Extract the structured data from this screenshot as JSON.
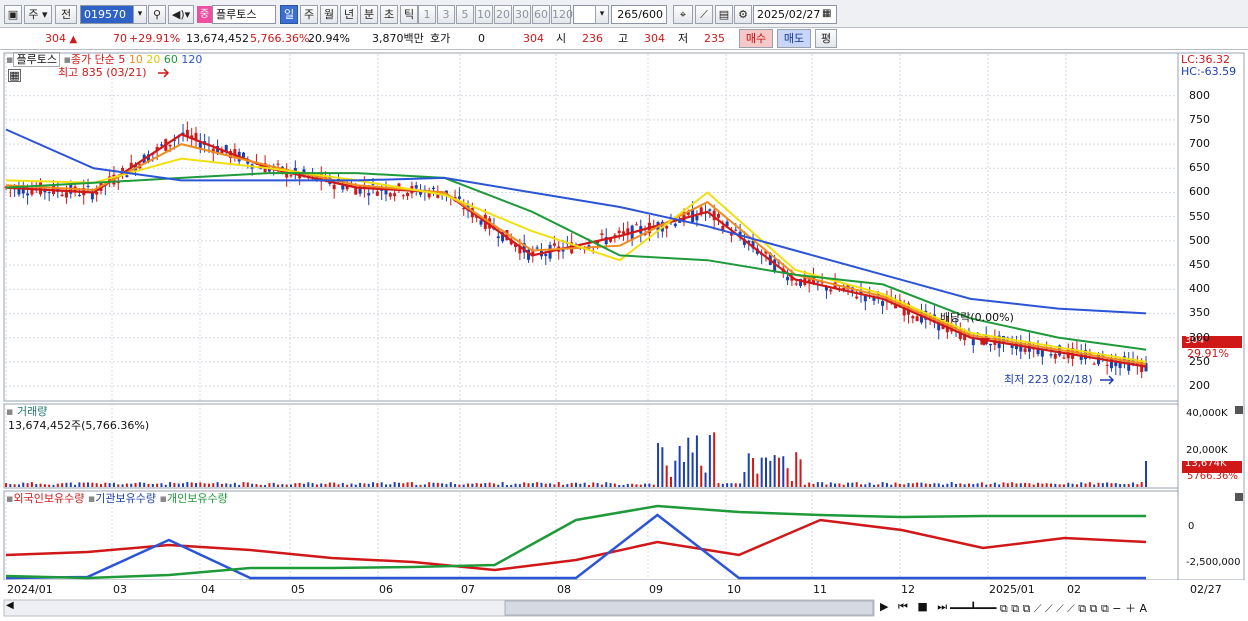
{
  "toolbar": {
    "period_type": "주",
    "prev_label": "전",
    "code": "019570",
    "stock_badge": "중",
    "stock_name": "플루토스",
    "periods": [
      "일",
      "주",
      "월",
      "년",
      "분",
      "초",
      "틱"
    ],
    "minutes": [
      "1",
      "3",
      "5",
      "10",
      "20",
      "30",
      "60",
      "120"
    ],
    "count": "265",
    "count_total": "/600",
    "date": "2025/02/27"
  },
  "quote": {
    "price": "304",
    "change": "70",
    "change_pct": "+29.91%",
    "volume": "13,674,452",
    "volume_ratio": "5,766.36%",
    "turnover": "20.94%",
    "amount": "3,870백만",
    "hoga_label": "호가",
    "hoga_value": "0",
    "hoga_price": "304",
    "open_label": "시",
    "open": "236",
    "high_label": "고",
    "high": "304",
    "low_label": "저",
    "low": "235",
    "buy_label": "매수",
    "sell_label": "매도",
    "eval_label": "평"
  },
  "price_panel": {
    "legend_name": "플루토스",
    "legend_ma": "종가 단순",
    "ma_periods": [
      "5",
      "10",
      "20",
      "60",
      "120"
    ],
    "ma_colors": [
      "#d01818",
      "#f08c1c",
      "#f0e010",
      "#1f9a3a",
      "#2b55d6"
    ],
    "high_note": "최고 835 (03/21)",
    "low_note": "최저 223 (02/18)",
    "dividend_note": "배당락(0.00%)",
    "lc": "LC:36.32",
    "hc": "HC:-63.59",
    "axis_ticks": [
      "800",
      "750",
      "700",
      "650",
      "600",
      "550",
      "500",
      "450",
      "400",
      "350",
      "300",
      "250",
      "200"
    ],
    "current_label": "304",
    "current_pct": "29.91%"
  },
  "volume_panel": {
    "title": "거래량",
    "value": "13,674,452주(5,766.36%)",
    "axis_ticks": [
      "40,000K",
      "20,000K"
    ],
    "current_label": "13,674K",
    "current_pct": "5766.36%"
  },
  "holding_panel": {
    "legends": [
      "외국인보유수량",
      "기관보유수량",
      "개인보유수량"
    ],
    "legend_colors": [
      "#d01818",
      "#2b55d6",
      "#1f9a3a"
    ],
    "axis_ticks": [
      "0",
      "-2,500,000"
    ]
  },
  "x_axis": {
    "labels": [
      "2024/01",
      "03",
      "04",
      "05",
      "06",
      "07",
      "08",
      "09",
      "10",
      "11",
      "12",
      "2025/01",
      "02"
    ],
    "end_label": "02/27"
  },
  "chart_data": {
    "type": "line",
    "x": [
      "2024/01",
      "03",
      "04",
      "05",
      "06",
      "07",
      "08",
      "09",
      "10",
      "11",
      "12",
      "2025/01",
      "02",
      "02/27"
    ],
    "series": [
      {
        "name": "5",
        "values": [
          610,
          600,
          720,
          650,
          610,
          600,
          470,
          510,
          560,
          420,
          380,
          300,
          270,
          240
        ]
      },
      {
        "name": "10",
        "values": [
          615,
          605,
          700,
          655,
          615,
          600,
          480,
          490,
          580,
          430,
          385,
          305,
          275,
          245
        ]
      },
      {
        "name": "20",
        "values": [
          625,
          620,
          670,
          650,
          625,
          595,
          520,
          460,
          600,
          440,
          390,
          310,
          280,
          250
        ]
      },
      {
        "name": "60",
        "values": [
          610,
          620,
          630,
          640,
          640,
          630,
          560,
          470,
          460,
          430,
          410,
          340,
          300,
          275
        ]
      },
      {
        "name": "120",
        "values": [
          730,
          650,
          625,
          625,
          625,
          630,
          600,
          570,
          530,
          480,
          430,
          380,
          360,
          350
        ]
      }
    ],
    "ylim": [
      200,
      820
    ]
  }
}
